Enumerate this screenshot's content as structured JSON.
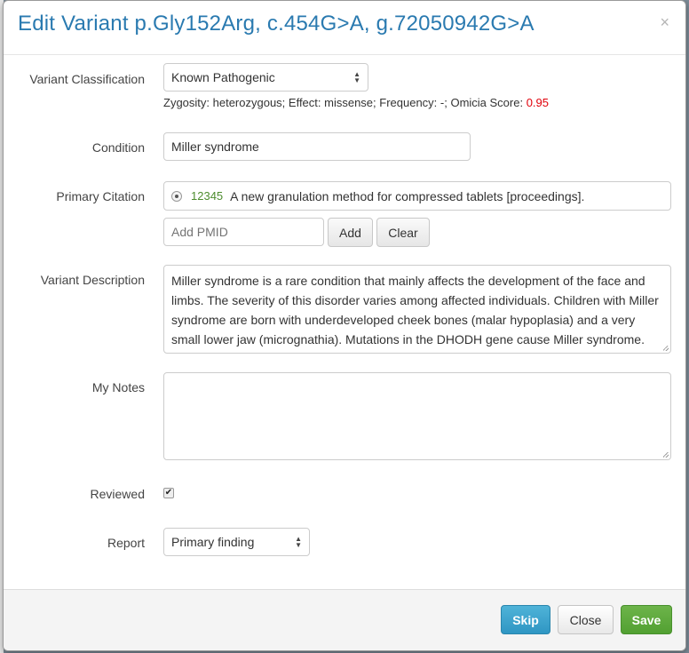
{
  "modal": {
    "title": "Edit Variant p.Gly152Arg, c.454G>A, g.72050942G>A",
    "close_glyph": "×"
  },
  "form": {
    "classification": {
      "label": "Variant Classification",
      "selected": "Known Pathogenic",
      "help_prefix": "Zygosity: heterozygous; Effect: missense; Frequency: -; Omicia Score: ",
      "score": "0.95",
      "score_color": "#e0000a"
    },
    "condition": {
      "label": "Condition",
      "value": "Miller syndrome"
    },
    "citation": {
      "label": "Primary Citation",
      "pmid": "12345",
      "title": "A new granulation method for compressed tablets [proceedings].",
      "add_placeholder": "Add PMID",
      "add_label": "Add",
      "clear_label": "Clear"
    },
    "description": {
      "label": "Variant Description",
      "value": "Miller syndrome is a rare condition that mainly affects the development of the face and limbs. The severity of this disorder varies among affected individuals. Children with Miller syndrome are born with underdeveloped cheek bones (malar hypoplasia) and a very small lower jaw (micrognathia). Mutations in the DHODH gene cause Miller syndrome. This"
    },
    "notes": {
      "label": "My Notes",
      "value": ""
    },
    "reviewed": {
      "label": "Reviewed",
      "checked": true,
      "check_glyph": "✔"
    },
    "report": {
      "label": "Report",
      "selected": "Primary finding"
    }
  },
  "footer": {
    "skip_label": "Skip",
    "close_label": "Close",
    "save_label": "Save",
    "colors": {
      "skip": "#2f96c3",
      "save": "#52a032"
    }
  }
}
